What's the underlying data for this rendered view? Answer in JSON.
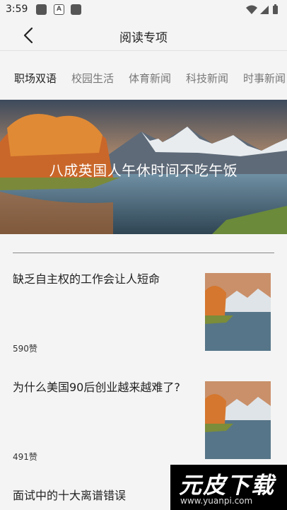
{
  "status_bar": {
    "time": "3:59",
    "notif_badge": "A"
  },
  "header": {
    "title": "阅读专项"
  },
  "tabs": [
    {
      "label": "职场双语",
      "active": true
    },
    {
      "label": "校园生活",
      "active": false
    },
    {
      "label": "体育新闻",
      "active": false
    },
    {
      "label": "科技新闻",
      "active": false
    },
    {
      "label": "时事新闻",
      "active": false
    }
  ],
  "hero": {
    "caption": "八成英国人午休时间不吃午饭"
  },
  "articles": [
    {
      "title": "缺乏自主权的工作会让人短命",
      "likes": "590赞"
    },
    {
      "title": "为什么美国90后创业越来越难了?",
      "likes": "491赞"
    },
    {
      "title": "面试中的十大离谱错误",
      "likes": ""
    }
  ],
  "watermark": {
    "brand": "元皮下载",
    "url": "www.yuanpi.com"
  }
}
